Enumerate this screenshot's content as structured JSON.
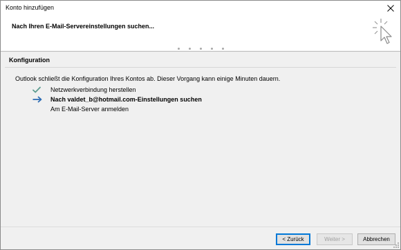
{
  "window": {
    "title": "Konto hinzufügen"
  },
  "header": {
    "title": "Nach Ihren E-Mail-Servereinstellungen suchen..."
  },
  "section": {
    "heading": "Konfiguration",
    "intro": "Outlook schließt die Konfiguration Ihres Kontos ab. Dieser Vorgang kann einige Minuten dauern."
  },
  "steps": [
    {
      "label": "Netzwerkverbindung herstellen",
      "status": "done",
      "icon": "checkmark-icon"
    },
    {
      "label": "Nach valdet_b@hotmail.com-Einstellungen suchen",
      "status": "active",
      "icon": "arrow-right-icon"
    },
    {
      "label": "Am E-Mail-Server anmelden",
      "status": "pending",
      "icon": "none"
    }
  ],
  "buttons": {
    "back": "< Zurück",
    "next": "Weiter >",
    "cancel": "Abbrechen"
  },
  "colors": {
    "checkmark": "#5c9c8f",
    "arrow": "#2e6db4",
    "default_button_border": "#0078d7"
  }
}
